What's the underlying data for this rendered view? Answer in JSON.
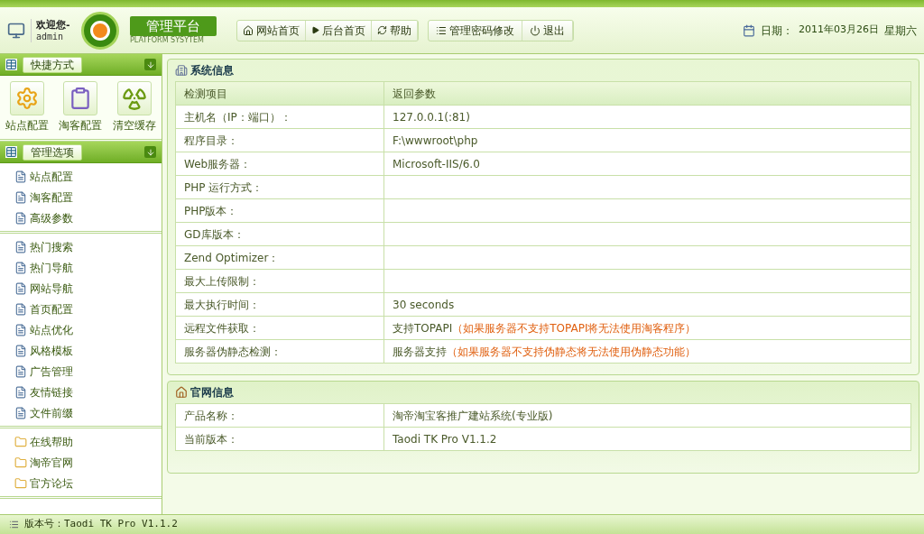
{
  "header": {
    "welcome": "欢迎您-",
    "user": "admin",
    "logo_title": "管理平台",
    "logo_subtitle": "PLATFORM SYSYTEM",
    "nav": [
      {
        "label": "网站首页"
      },
      {
        "label": "后台首页"
      },
      {
        "label": "帮助"
      }
    ],
    "nav2": [
      {
        "label": "管理密码修改"
      },
      {
        "label": "退出"
      }
    ],
    "date_label": "日期：",
    "date": "2011年03月26日",
    "weekday": "星期六"
  },
  "sidebar": {
    "shortcuts": {
      "title": "快捷方式",
      "items": [
        {
          "label": "站点配置"
        },
        {
          "label": "淘客配置"
        },
        {
          "label": "清空缓存"
        }
      ]
    },
    "manage": {
      "title": "管理选项",
      "groups": [
        [
          "站点配置",
          "淘客配置",
          "高级参数"
        ],
        [
          "热门搜索",
          "热门导航",
          "网站导航",
          "首页配置",
          "站点优化",
          "风格模板",
          "广告管理",
          "友情链接",
          "文件前缀"
        ],
        [
          "在线帮助",
          "淘帝官网",
          "官方论坛"
        ]
      ]
    }
  },
  "system_info": {
    "title": "系统信息",
    "columns": [
      "检测项目",
      "返回参数"
    ],
    "rows": [
      {
        "label": "主机名（IP：端口）：",
        "value": "127.0.0.1(:81)"
      },
      {
        "label": "程序目录：",
        "value": "F:\\wwwroot\\php"
      },
      {
        "label": "Web服务器：",
        "value": "Microsoft-IIS/6.0"
      },
      {
        "label": "PHP 运行方式："
      },
      {
        "label": "PHP版本："
      },
      {
        "label": "GD库版本："
      },
      {
        "label": "Zend Optimizer："
      },
      {
        "label": "最大上传限制："
      },
      {
        "label": "最大执行时间：",
        "value": "30 seconds"
      },
      {
        "label": "远程文件获取：",
        "value": "支持TOPAPI",
        "note": "（如果服务器不支持TOPAPI将无法使用淘客程序）"
      },
      {
        "label": "服务器伪静态检测：",
        "value": "服务器支持",
        "note": "（如果服务器不支持伪静态将无法使用伪静态功能）"
      }
    ]
  },
  "site_info": {
    "title": "官网信息",
    "rows": [
      {
        "label": "产品名称：",
        "value": "淘帝淘宝客推广建站系统(专业版)"
      },
      {
        "label": "当前版本：",
        "value": "Taodi TK Pro V1.1.2"
      }
    ]
  },
  "status_bar": {
    "version": "版本号：Taodi TK Pro V1.1.2"
  }
}
